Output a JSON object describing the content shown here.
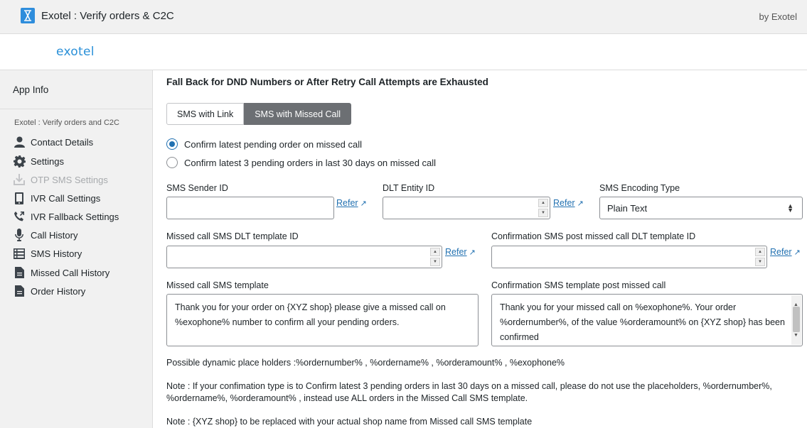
{
  "header": {
    "app_title": "Exotel : Verify orders & C2C",
    "by_text": "by Exotel",
    "logo_text": "exotel"
  },
  "sidebar": {
    "app_info": "App Info",
    "section_title": "Exotel : Verify orders and C2C",
    "items": [
      {
        "label": "Contact Details",
        "icon": "user-icon",
        "disabled": false
      },
      {
        "label": "Settings",
        "icon": "gear-icon",
        "disabled": false
      },
      {
        "label": "OTP SMS Settings",
        "icon": "download-icon",
        "disabled": true
      },
      {
        "label": "IVR Call Settings",
        "icon": "phone-device-icon",
        "disabled": false
      },
      {
        "label": "IVR Fallback Settings",
        "icon": "phone-callback-icon",
        "disabled": false
      },
      {
        "label": "Call History",
        "icon": "microphone-icon",
        "disabled": false
      },
      {
        "label": "SMS History",
        "icon": "list-icon",
        "disabled": false
      },
      {
        "label": "Missed Call History",
        "icon": "document-icon",
        "disabled": false
      },
      {
        "label": "Order History",
        "icon": "document-icon",
        "disabled": false
      }
    ]
  },
  "main": {
    "section_title": "Fall Back for DND Numbers or After Retry Call Attempts are Exhausted",
    "tabs": [
      {
        "label": "SMS with Link",
        "active": false
      },
      {
        "label": "SMS with Missed Call",
        "active": true
      }
    ],
    "radios": [
      {
        "label": "Confirm latest pending order on missed call",
        "checked": true
      },
      {
        "label": "Confirm latest 3 pending orders in last 30 days on missed call",
        "checked": false
      }
    ],
    "fields": {
      "sms_sender_id": {
        "label": "SMS Sender ID",
        "value": ""
      },
      "dlt_entity_id": {
        "label": "DLT Entity ID",
        "value": ""
      },
      "sms_encoding_type": {
        "label": "SMS Encoding Type",
        "value": "Plain Text"
      },
      "missed_call_dlt_template_id": {
        "label": "Missed call SMS DLT template ID",
        "value": ""
      },
      "confirmation_dlt_template_id": {
        "label": "Confirmation SMS post missed call DLT template ID",
        "value": ""
      },
      "missed_call_template": {
        "label": "Missed call SMS template",
        "line1": "Thank you for your order on {XYZ shop} please give a missed call on",
        "line2": "%exophone% number to confirm all your pending orders."
      },
      "confirmation_template": {
        "label": "Confirmation SMS template post missed call",
        "line1": "Thank you for your missed call on %exophone%. Your order",
        "line2": "%ordernumber%, of the value %orderamount% on {XYZ shop} has been",
        "line3": "confirmed"
      }
    },
    "refer_label": "Refer",
    "notes": {
      "placeholders": "Possible dynamic place holders :%ordernumber% , %ordername% , %orderamount% , %exophone%",
      "note1_line1": "Note : If your confimation type is to Confirm latest 3 pending orders in last 30 days on a missed call, please do not use the placeholders, %ordernumber%,",
      "note1_line2": "%ordername%, %orderamount% , instead use ALL orders in the Missed Call SMS template.",
      "note2": "Note : {XYZ shop} to be replaced with your actual shop name from Missed call SMS template"
    }
  },
  "colors": {
    "accent": "#2271b1",
    "active_tab": "#6c6f73",
    "sidebar_bg": "#f1f1f1",
    "logo": "#2a90d8"
  }
}
